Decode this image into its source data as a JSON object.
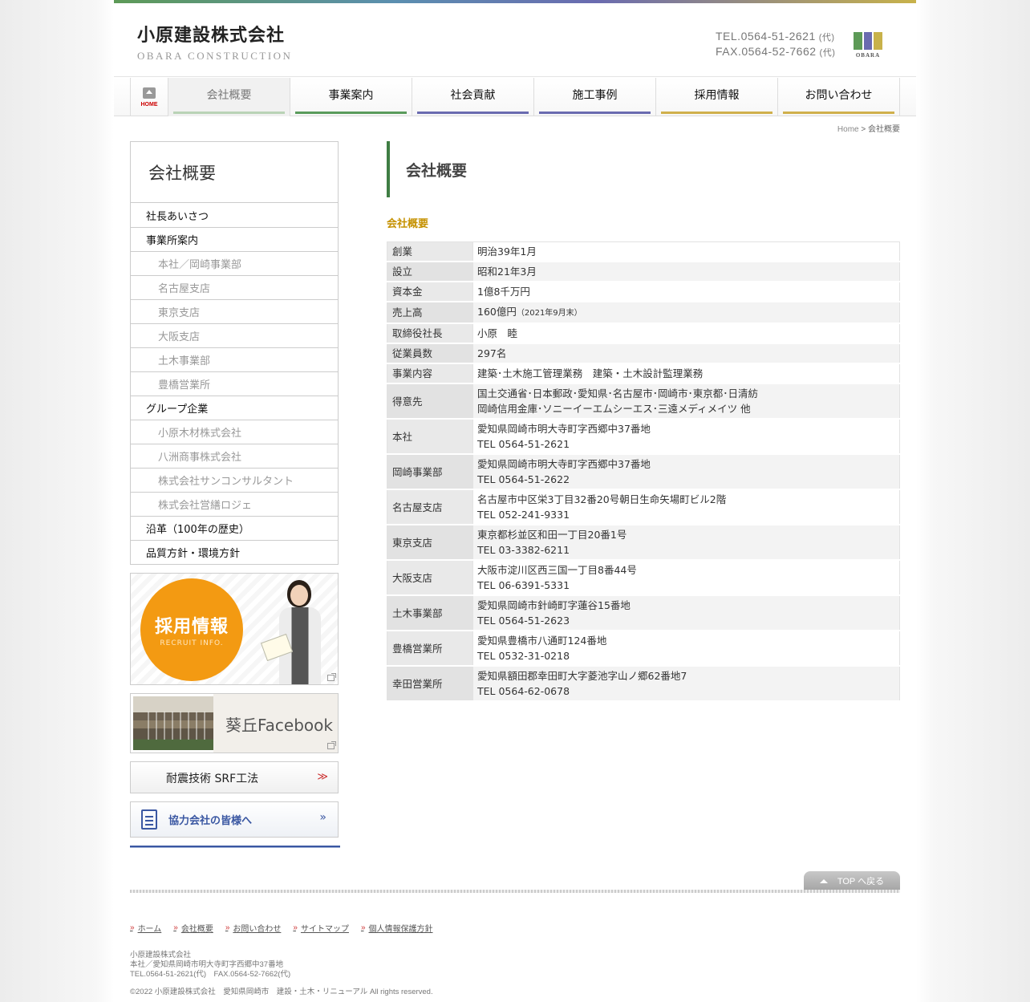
{
  "header": {
    "logo_ja": "小原建設株式会社",
    "logo_en": "OBARA CONSTRUCTION",
    "tel": "TEL.0564-51-2621",
    "fax": "FAX.0564-52-7662",
    "dai": "(代)",
    "mark_word": "OBARA",
    "mark_colors": [
      "#5d9a57",
      "#6a6bb0",
      "#c8b24a"
    ]
  },
  "nav": {
    "home": "HOME",
    "items": [
      {
        "label": "会社概要",
        "color": "#b9d3b6"
      },
      {
        "label": "事業案内",
        "color": "#5a9b5c"
      },
      {
        "label": "社会貢献",
        "color": "#6a6bb0"
      },
      {
        "label": "施工事例",
        "color": "#6a6bb0"
      },
      {
        "label": "採用情報",
        "color": "#d0b04c"
      },
      {
        "label": "お問い合わせ",
        "color": "#d0b04c"
      }
    ]
  },
  "breadcrumb": {
    "home": "Home",
    "sep": " > ",
    "current": "会社概要"
  },
  "sidebar": {
    "title": "会社概要",
    "items": [
      {
        "label": "社長あいさつ",
        "level": 1
      },
      {
        "label": "事業所案内",
        "level": 1
      },
      {
        "label": "本社／岡崎事業部",
        "level": 2
      },
      {
        "label": "名古屋支店",
        "level": 2
      },
      {
        "label": "東京支店",
        "level": 2
      },
      {
        "label": "大阪支店",
        "level": 2
      },
      {
        "label": "土木事業部",
        "level": 2
      },
      {
        "label": "豊橋営業所",
        "level": 2
      },
      {
        "label": "グループ企業",
        "level": 1
      },
      {
        "label": "小原木材株式会社",
        "level": 2
      },
      {
        "label": "八洲商事株式会社",
        "level": 2
      },
      {
        "label": "株式会社サンコンサルタント",
        "level": 2
      },
      {
        "label": "株式会社営繕ロジェ",
        "level": 2
      },
      {
        "label": "沿革（100年の歴史）",
        "level": 1
      },
      {
        "label": "品質方針・環境方針",
        "level": 1
      }
    ],
    "recruit_title": "採用情報",
    "recruit_sub": "RECRUIT INFO.",
    "facebook": "葵丘Facebook",
    "srf": "耐震技術 SRF工法",
    "srf_arrows": "≫",
    "partner": "協力会社の皆様へ",
    "partner_arrows": "»"
  },
  "main": {
    "page_title": "会社概要",
    "section_title": "会社概要",
    "rows": [
      {
        "label": "創業",
        "lines": [
          "明治39年1月"
        ]
      },
      {
        "label": "設立",
        "lines": [
          "昭和21年3月"
        ]
      },
      {
        "label": "資本金",
        "lines": [
          "1億8千万円"
        ]
      },
      {
        "label": "売上高",
        "lines": [
          "160億円"
        ],
        "note": "（2021年9月末）"
      },
      {
        "label": "取締役社長",
        "lines": [
          "小原　睦"
        ]
      },
      {
        "label": "従業員数",
        "lines": [
          "297名"
        ]
      },
      {
        "label": "事業内容",
        "lines": [
          "建築･土木施工管理業務　建築・土木設計監理業務"
        ]
      },
      {
        "label": "得意先",
        "lines": [
          "国土交通省･日本郵政･愛知県･名古屋市･岡崎市･東京都･日清紡",
          "岡崎信用金庫･ソニーイーエムシーエス･三遠メディメイツ 他"
        ]
      },
      {
        "label": "本社",
        "lines": [
          "愛知県岡崎市明大寺町字西郷中37番地",
          "TEL 0564-51-2621"
        ]
      },
      {
        "label": "岡崎事業部",
        "lines": [
          "愛知県岡崎市明大寺町字西郷中37番地",
          "TEL 0564-51-2622"
        ]
      },
      {
        "label": "名古屋支店",
        "lines": [
          "名古屋市中区栄3丁目32番20号朝日生命矢場町ビル2階",
          "TEL 052-241-9331"
        ]
      },
      {
        "label": "東京支店",
        "lines": [
          "東京都杉並区和田一丁目20番1号",
          "TEL 03-3382-6211"
        ]
      },
      {
        "label": "大阪支店",
        "lines": [
          "大阪市淀川区西三国一丁目8番44号",
          "TEL 06-6391-5331"
        ]
      },
      {
        "label": "土木事業部",
        "lines": [
          "愛知県岡崎市針崎町字蓮谷15番地",
          "TEL 0564-51-2623"
        ]
      },
      {
        "label": "豊橋営業所",
        "lines": [
          "愛知県豊橋市八通町124番地",
          "TEL 0532-31-0218"
        ]
      },
      {
        "label": "幸田営業所",
        "lines": [
          "愛知県額田郡幸田町大字菱池字山ノ郷62番地7",
          "TEL 0564-62-0678"
        ]
      }
    ]
  },
  "footer": {
    "to_top": "TOP へ戻る",
    "links": [
      "ホーム",
      "会社概要",
      "お問い合わせ",
      "サイトマップ",
      "個人情報保護方針"
    ],
    "link_marker": "»",
    "company": "小原建設株式会社",
    "address": "本社／愛知県岡崎市明大寺町字西郷中37番地",
    "telfax": "TEL.0564-51-2621(代)　FAX.0564-52-7662(代)",
    "copyright": "©2022 小原建設株式会社　愛知県岡崎市　建設・土木・リニューアル All rights reserved."
  }
}
